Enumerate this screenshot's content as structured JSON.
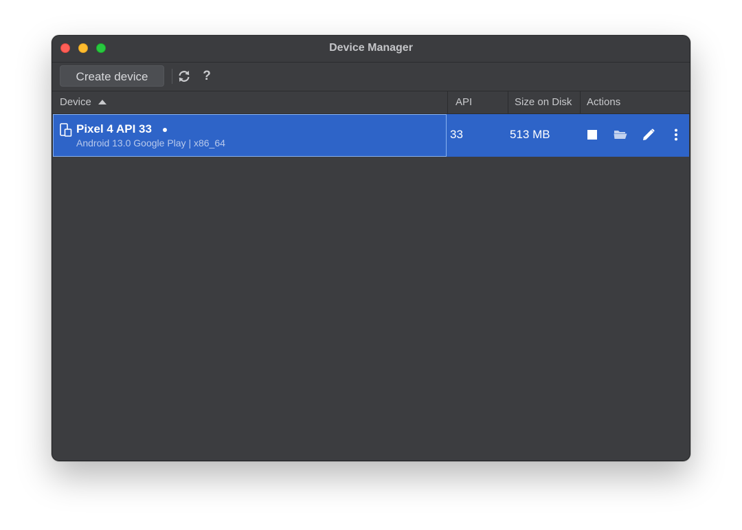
{
  "window": {
    "title": "Device Manager"
  },
  "toolbar": {
    "create_label": "Create device",
    "refresh_icon": "refresh-icon",
    "help_label": "?"
  },
  "table": {
    "columns": {
      "device": "Device",
      "api": "API",
      "size": "Size on Disk",
      "actions": "Actions"
    },
    "sort": "ascending",
    "rows": [
      {
        "name": "Pixel 4 API 33",
        "subtitle": "Android 13.0 Google Play | x86_64",
        "api": "33",
        "size": "513 MB",
        "running": true,
        "actions": [
          "stop-icon",
          "folder-icon",
          "edit-icon",
          "more-icon"
        ]
      }
    ]
  },
  "colors": {
    "window_bg": "#3c3d40",
    "selection": "#2e64c8",
    "close": "#fe5f57",
    "minimize": "#febc2e",
    "maximize": "#28c840"
  }
}
